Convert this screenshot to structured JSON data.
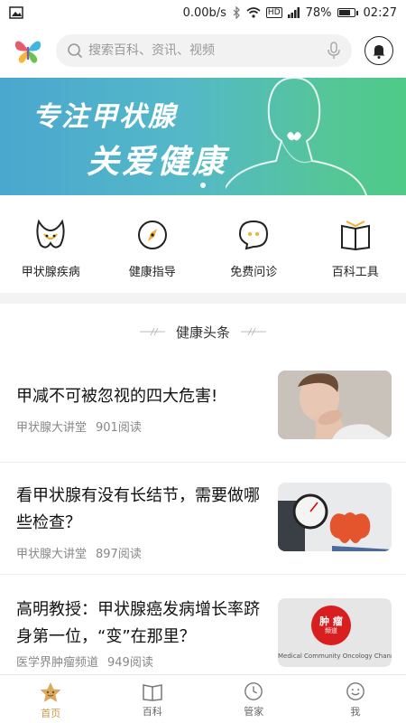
{
  "status_bar": {
    "speed": "0.00b/s",
    "battery": "78%",
    "battery_level": 0.78,
    "time": "02:27",
    "network": "HD"
  },
  "header": {
    "search_placeholder": "搜索百科、资讯、视频"
  },
  "banner": {
    "line1": "专注甲状腺",
    "line2": "关爱健康"
  },
  "quick_nav": [
    {
      "label": "甲状腺疾病",
      "icon": "thyroid-icon"
    },
    {
      "label": "健康指导",
      "icon": "compass-icon"
    },
    {
      "label": "免费问诊",
      "icon": "chat-bubble-icon"
    },
    {
      "label": "百科工具",
      "icon": "book-icon"
    }
  ],
  "section": {
    "title": "健康头条"
  },
  "articles": [
    {
      "title": "甲减不可被忽视的四大危害!",
      "source": "甲状腺大讲堂",
      "reads": "901阅读"
    },
    {
      "title": "看甲状腺有没有长结节，需要做哪些检查？",
      "source": "甲状腺大讲堂",
      "reads": "897阅读"
    },
    {
      "title": "高明教授：甲状腺癌发病增长率跻身第一位，“变”在那里？",
      "source": "医学界肿瘤频道",
      "reads": "949阅读",
      "thumb_logo_top": "肿 瘤",
      "thumb_logo_bottom": "频道",
      "thumb_caption": "Medical Community Oncology Chann"
    }
  ],
  "bottom_nav": [
    {
      "label": "首页",
      "icon": "home-star-icon",
      "active": true
    },
    {
      "label": "百科",
      "icon": "open-book-icon",
      "active": false
    },
    {
      "label": "管家",
      "icon": "clock-icon",
      "active": false
    },
    {
      "label": "我",
      "icon": "smiley-icon",
      "active": false
    }
  ],
  "colors": {
    "accent": "#c89a4a",
    "banner_start": "#4aa7cf",
    "banner_end": "#4ecb86",
    "oncology_red": "#d81e1e"
  }
}
